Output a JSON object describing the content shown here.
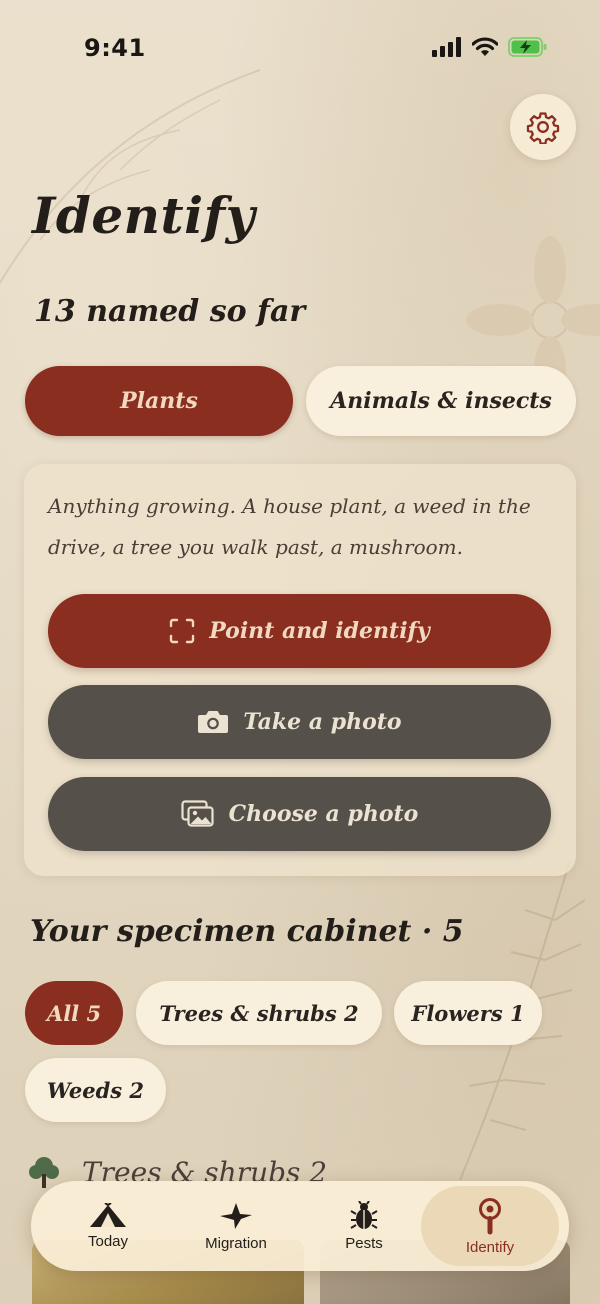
{
  "status_bar": {
    "time": "9:41"
  },
  "page": {
    "title": "Identify",
    "subtitle": "13 named so far"
  },
  "segments": [
    {
      "label": "Plants",
      "selected": true
    },
    {
      "label": "Animals & insects",
      "selected": false
    }
  ],
  "card": {
    "description": "Anything growing. A house plant, a weed in the drive, a tree you walk past, a mushroom.",
    "actions": [
      {
        "label": "Point and identify",
        "icon": "scan-frame-icon"
      },
      {
        "label": "Take a photo",
        "icon": "camera-icon"
      },
      {
        "label": "Choose a photo",
        "icon": "photo-library-icon"
      }
    ]
  },
  "cabinet": {
    "heading": "Your specimen cabinet · 5",
    "filters": [
      {
        "label": "All 5",
        "selected": true
      },
      {
        "label": "Trees & shrubs 2",
        "selected": false
      },
      {
        "label": "Flowers 1",
        "selected": false
      },
      {
        "label": "Weeds 2",
        "selected": false
      }
    ],
    "section": {
      "label": "Trees & shrubs 2",
      "icon": "tree-icon"
    }
  },
  "tabbar": {
    "tabs": [
      {
        "label": "Today",
        "icon": "tent-icon",
        "selected": false
      },
      {
        "label": "Migration",
        "icon": "bird-icon",
        "selected": false
      },
      {
        "label": "Pests",
        "icon": "beetle-icon",
        "selected": false
      },
      {
        "label": "Identify",
        "icon": "magnifier-icon",
        "selected": true
      }
    ]
  },
  "colors": {
    "accent": "#8a2e20",
    "dark_button": "#56504a",
    "cream": "#f8efdc",
    "background": "#e6dcc8"
  }
}
